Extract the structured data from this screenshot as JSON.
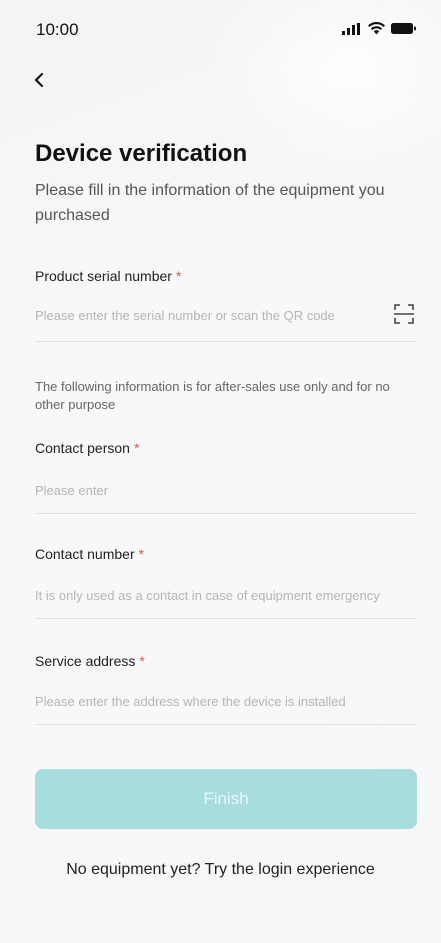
{
  "status": {
    "time": "10:00"
  },
  "page": {
    "title": "Device verification",
    "subtitle": "Please fill in the information of the equipment you purchased"
  },
  "form": {
    "serial": {
      "label": "Product serial number",
      "required": "*",
      "placeholder": "Please enter the serial number or scan the QR code"
    },
    "note": "The following information is for after-sales use only and for no other purpose",
    "contact_person": {
      "label": "Contact person",
      "required": "*",
      "placeholder": "Please enter"
    },
    "contact_number": {
      "label": "Contact number",
      "required": "*",
      "placeholder": "It is only used as a contact in case of equipment emergency"
    },
    "service_address": {
      "label": "Service address",
      "required": "*",
      "placeholder": "Please enter the address where the device is installed"
    },
    "finish_label": "Finish"
  },
  "footer": {
    "login_link": "No equipment yet? Try the login experience"
  },
  "colors": {
    "accent_disabled": "#a8dde0",
    "required_star": "#e4573d"
  },
  "icons": {
    "back": "chevron-left-icon",
    "scan": "scan-qr-icon",
    "signal": "signal-icon",
    "wifi": "wifi-icon",
    "battery": "battery-icon"
  }
}
